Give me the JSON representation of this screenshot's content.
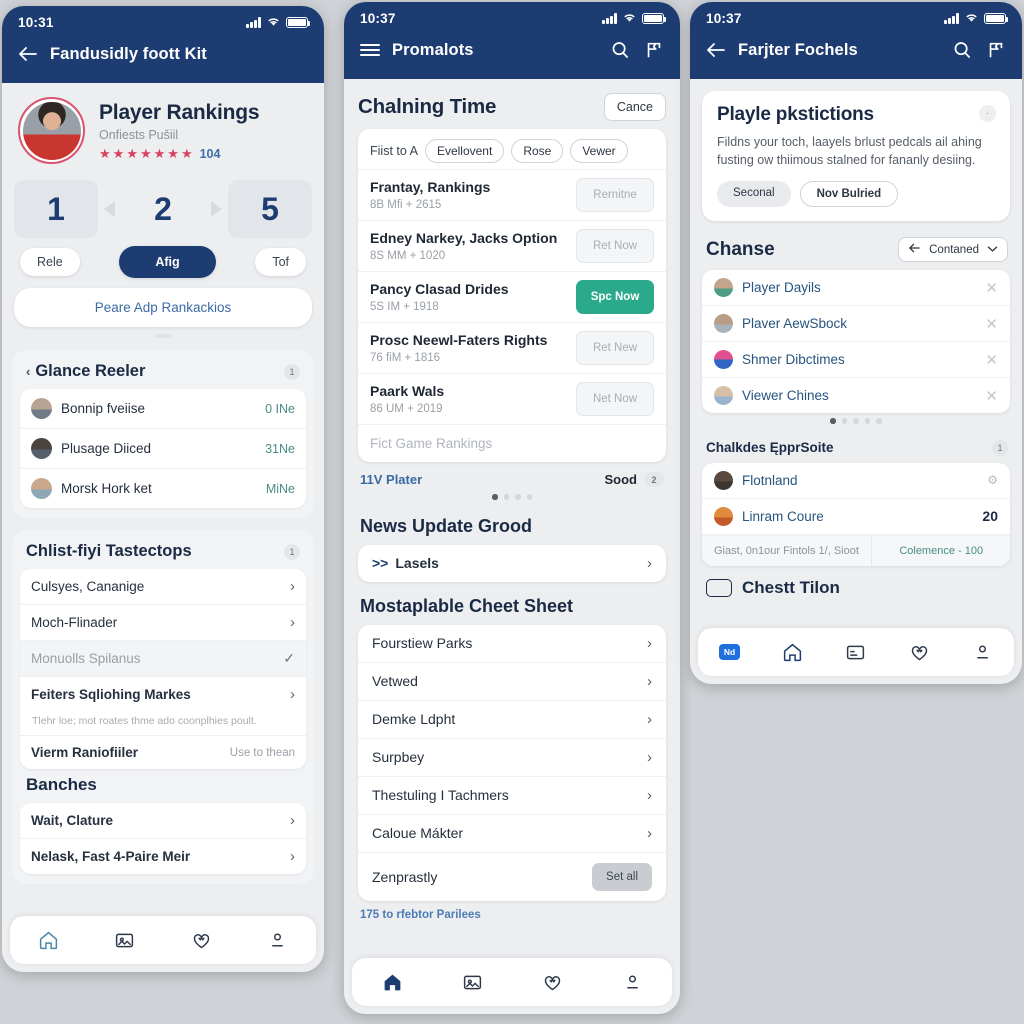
{
  "left": {
    "status": {
      "time": "10:31"
    },
    "nav": {
      "back_icon": "arrow-left-icon",
      "title": "Fandusidly foott Kit"
    },
    "profile": {
      "name": "Player Rankings",
      "subtitle": "Onfiests Pušiil",
      "rating_count": "104",
      "stars": 7
    },
    "tiles": [
      "1",
      "2",
      "5"
    ],
    "pills": {
      "left": "Rele",
      "center": "Afig",
      "right": "Tof"
    },
    "wide_button": "Peare Adp Rankackios",
    "glance": {
      "title": "Glance Reeler",
      "badge": "1",
      "rows": [
        {
          "name": "Bonnip fveiise",
          "value": "0 INe"
        },
        {
          "name": "Plusage Diiced",
          "value": "31Ne"
        },
        {
          "name": "Morsk Hork ket",
          "value": "MiNe"
        }
      ]
    },
    "checklist": {
      "title": "Chlist-fiyi Tastectops",
      "badge": "1",
      "rows": [
        {
          "label": "Culsyes, Cananige",
          "type": "chevron"
        },
        {
          "label": "Moch-Flinader",
          "type": "chevron"
        },
        {
          "label": "Monuolls Spilanus",
          "type": "tick"
        },
        {
          "label": "Feiters Sqliohing Markes",
          "type": "chevron",
          "note": "Tlehr loe; mot roates thme ado coonplhies poult."
        },
        {
          "label": "Vierm Raniofiiler",
          "type": "note",
          "note": "Use to thean"
        }
      ]
    },
    "branches": {
      "title": "Banches",
      "rows": [
        {
          "label": "Wait, Clature"
        },
        {
          "label": "Nelask, Fast 4-Paire Meir"
        }
      ]
    },
    "tabs": [
      "home-icon",
      "card-icon",
      "heart-icon",
      "profile-icon"
    ]
  },
  "middle": {
    "status": {
      "time": "10:37"
    },
    "nav": {
      "menu_icon": "hamburger-icon",
      "title": "Promalots",
      "search_icon": "search-icon",
      "flag_icon": "flag-icon"
    },
    "header": {
      "title": "Chalning Time",
      "action": "Cance"
    },
    "filters": {
      "label": "Fiist to A",
      "chips": [
        "Evellovent",
        "Rose",
        "Vewer"
      ]
    },
    "rows": [
      {
        "title": "Frantay, Rankings",
        "sub": "8B Mfi + 2615",
        "button": "Rernitne",
        "primary": false
      },
      {
        "title": "Edney Narkey, Jacks Option",
        "sub": "8S MM + 1020",
        "button": "Ret Now",
        "primary": false
      },
      {
        "title": "Pancy Clasad Drides",
        "sub": "5S IM + 1918",
        "button": "Spc Now",
        "primary": true
      },
      {
        "title": "Prosc Neewl-Faters Rights",
        "sub": "76 fiM + 1816",
        "button": "Ret New",
        "primary": false
      },
      {
        "title": "Paark Wals",
        "sub": "86 UM + 2019",
        "button": "Net Now",
        "primary": false
      }
    ],
    "ghost_row": "Fict Game Rankings",
    "foot": {
      "link": "11V Plater",
      "label": "Sood",
      "badge": "2"
    },
    "dots": {
      "count": 4,
      "active": 0
    },
    "news": {
      "title": "News Update Grood",
      "row": "Lasels",
      "arrows": ">>"
    },
    "cheat": {
      "title": "Mostaplable Cheet Sheet",
      "rows": [
        "Fourstiew Parks",
        "Vetwed",
        "Demke Ldpht",
        "Surpbey",
        "Thestuling I Tachmers",
        "Caloue Mákter"
      ],
      "last_row": {
        "label": "Zenprastly",
        "button": "Set all"
      },
      "link": "175 to rfebtor Parilees"
    },
    "tabs": [
      "home-icon",
      "card-icon",
      "heart-icon",
      "profile-icon"
    ]
  },
  "right": {
    "status": {
      "time": "10:37"
    },
    "nav": {
      "back_icon": "arrow-left-icon",
      "title": "Farjter Fochels",
      "search_icon": "search-icon",
      "flag_icon": "flag-icon"
    },
    "card": {
      "title": "Playle pkstictions",
      "body": "Fildns your toch, laayels brlust pedcals ail ahing fusting ow thiimous stalned for fananly desiing.",
      "buttons": [
        "Seconal",
        "Nov Bulried"
      ]
    },
    "chanse": {
      "title": "Chanse",
      "select": {
        "icon": "arrow-left-icon",
        "label": "Contaned",
        "caret": "chevron-down-icon"
      },
      "rows": [
        "Player Dayils",
        "Plaver AewSbock",
        "Shmer Dibctimes",
        "Viewer Chines"
      ]
    },
    "dots": {
      "count": 5,
      "active": 0
    },
    "expr": {
      "title": "Chalkdes ĘpprSoite",
      "badge": "1",
      "rows": [
        {
          "label": "Flotnland",
          "value": "",
          "icon": "gear-icon"
        },
        {
          "label": "Linram Coure",
          "value": "20",
          "icon": ""
        }
      ],
      "foot_left": "Giast, 0n1our Fintols 1/, Sioot",
      "foot_right": "Colemence - 100"
    },
    "bottom": {
      "label": "Chestt Tilon"
    },
    "tabs": [
      "badge-icon",
      "home-icon",
      "card-icon",
      "heart-icon",
      "profile-icon"
    ],
    "tab_badge": "Nd"
  }
}
